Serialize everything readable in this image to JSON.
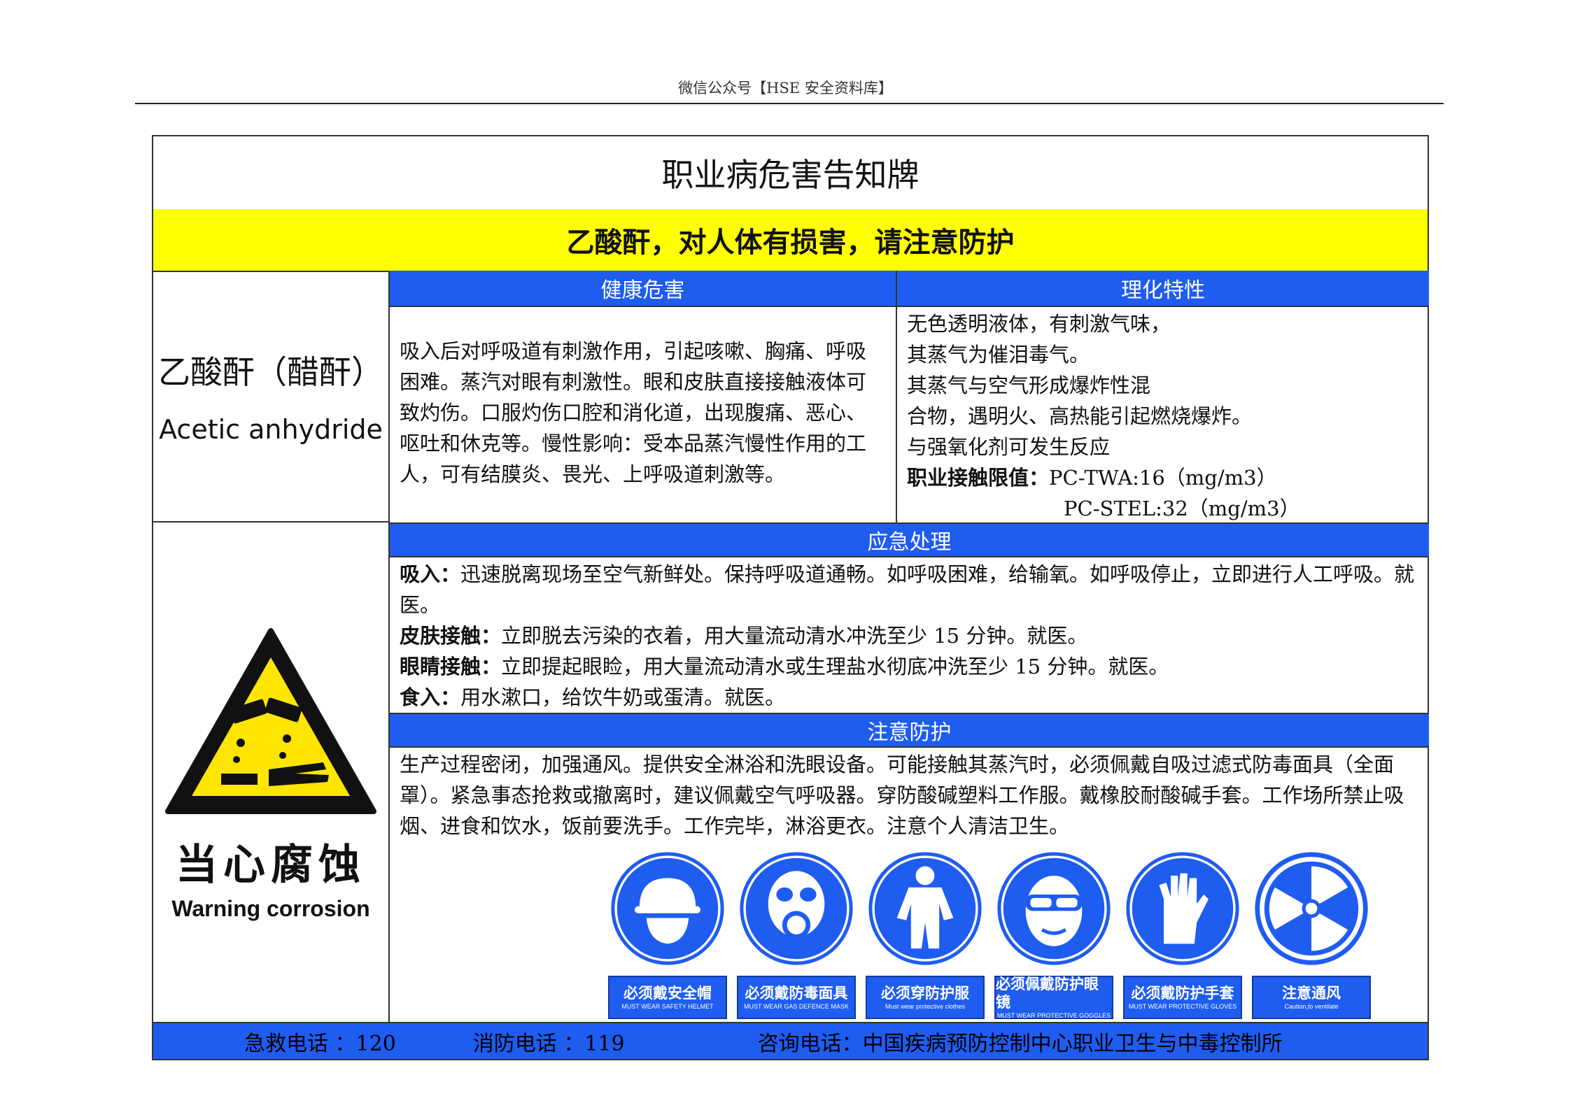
{
  "header": {
    "text": "微信公众号【HSE 安全资料库】"
  },
  "board": {
    "title": "职业病危害告知牌",
    "warning": "乙酸酐，对人体有损害，请注意防护",
    "chemical": {
      "name_cn": "乙酸酐（醋酐）",
      "name_en": "Acetic anhydride"
    },
    "hazard_sign": {
      "label_cn": "当心腐蚀",
      "label_en": "Warning corrosion"
    },
    "health": {
      "heading": "健康危害",
      "text": "吸入后对呼吸道有刺激作用，引起咳嗽、胸痛、呼吸困难。蒸汽对眼有刺激性。眼和皮肤直接接触液体可致灼伤。口服灼伤口腔和消化道，出现腹痛、恶心、呕吐和休克等。慢性影响：受本品蒸汽慢性作用的工人，可有结膜炎、畏光、上呼吸道刺激等。"
    },
    "properties": {
      "heading": "理化特性",
      "lines": [
        "无色透明液体，有刺激气味，",
        "其蒸气为催泪毒气。",
        "其蒸气与空气形成爆炸性混",
        "合物，遇明火、高热能引起燃烧爆炸。",
        "与强氧化剂可发生反应"
      ],
      "limit_label": "职业接触限值：",
      "twa": "PC-TWA:16（mg/m3）",
      "stel": "PC-STEL:32（mg/m3）"
    },
    "emergency": {
      "heading": "应急处理",
      "items": [
        {
          "label": "吸入：",
          "text": "迅速脱离现场至空气新鲜处。保持呼吸道通畅。如呼吸困难，给输氧。如呼吸停止，立即进行人工呼吸。就医。"
        },
        {
          "label": "皮肤接触：",
          "text": "立即脱去污染的衣着，用大量流动清水冲洗至少 15 分钟。就医。"
        },
        {
          "label": "眼睛接触：",
          "text": "立即提起眼睑，用大量流动清水或生理盐水彻底冲洗至少 15 分钟。就医。"
        },
        {
          "label": "食入：",
          "text": "用水漱口，给饮牛奶或蛋清。就医。"
        }
      ]
    },
    "protection": {
      "heading": "注意防护",
      "text": "生产过程密闭，加强通风。提供安全淋浴和洗眼设备。可能接触其蒸汽时，必须佩戴自吸过滤式防毒面具（全面罩）。紧急事态抢救或撤离时，建议佩戴空气呼吸器。穿防酸碱塑料工作服。戴橡胶耐酸碱手套。工作场所禁止吸烟、进食和饮水，饭前要洗手。工作完毕，淋浴更衣。注意个人清洁卫生。",
      "signs": [
        {
          "icon": "helmet-icon",
          "cn": "必须戴安全帽",
          "en": "MUST WEAR SAFETY HELMET"
        },
        {
          "icon": "gas-mask-icon",
          "cn": "必须戴防毒面具",
          "en": "MUST WEAR GAS DEFENCE MASK"
        },
        {
          "icon": "protective-clothes-icon",
          "cn": "必须穿防护服",
          "en": "Must wear protective clothes"
        },
        {
          "icon": "goggles-icon",
          "cn": "必须佩戴防护眼镜",
          "en": "MUST WEAR PROTECTIVE GOGGLES"
        },
        {
          "icon": "gloves-icon",
          "cn": "必须戴防护手套",
          "en": "MUST WEAR PROTECTIVE GLOVES"
        },
        {
          "icon": "ventilation-icon",
          "cn": "注意通风",
          "en": "Caution,to ventilate"
        }
      ]
    },
    "footer": {
      "first_aid": "急救电话 ：120",
      "fire": "消防电话 ：119",
      "consult": "咨询电话：中国疾病预防控制中心职业卫生与中毒控制所"
    }
  },
  "colors": {
    "blue": "#1f5cf0",
    "yellow": "#ffff00",
    "warning_yellow": "#ffe600"
  }
}
